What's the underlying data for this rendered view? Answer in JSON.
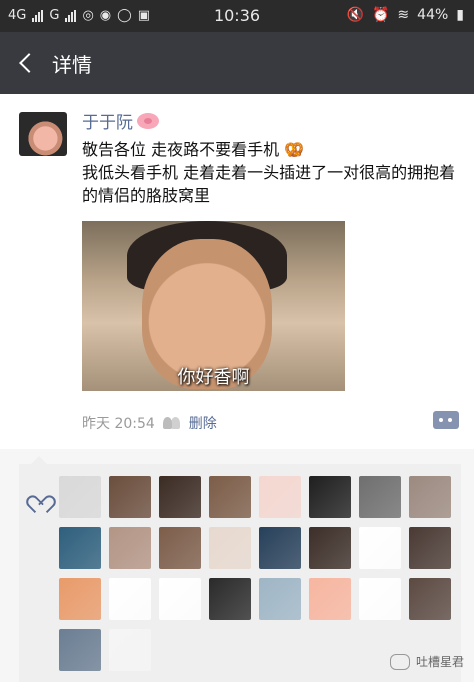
{
  "statusbar": {
    "network1": "4G",
    "network2": "G",
    "time": "10:36",
    "battery": "44%",
    "icons": [
      "signal-icon",
      "wechat-icon",
      "weibo-icon",
      "notification-icon",
      "s-badge-icon",
      "mute-icon",
      "alarm-icon",
      "wifi-icon",
      "battery-icon"
    ]
  },
  "nav": {
    "title": "详情"
  },
  "post": {
    "author": "于于阮",
    "text_line1": "敬告各位 走夜路不要看手机",
    "text_line2": "我低头看手机 走着走着一头插进了一对很高的拥抱着的情侣的胳肢窝里",
    "image_caption": "你好香啊",
    "time": "昨天 20:54",
    "delete_label": "删除"
  },
  "likes": {
    "colors": [
      "#d9d9d9",
      "#6b4e3d",
      "#3b2b23",
      "#7c5d48",
      "#f4d7d0",
      "#1f1f1f",
      "#6f6f6f",
      "#9c8a80",
      "#2e5f7d",
      "#b39585",
      "#7d5d4a",
      "#e7d9cf",
      "#27405a",
      "#3c2e28",
      "#ffffff",
      "#4a3a34",
      "#e99b6a",
      "#ffffff",
      "#ffffff",
      "#2a2a2a",
      "#9fb6c6",
      "#f7b6a0",
      "#ffffff",
      "#5b4a42",
      "#6b7e93",
      "#f5f5f5"
    ]
  },
  "watermark": {
    "text": "吐槽星君"
  }
}
